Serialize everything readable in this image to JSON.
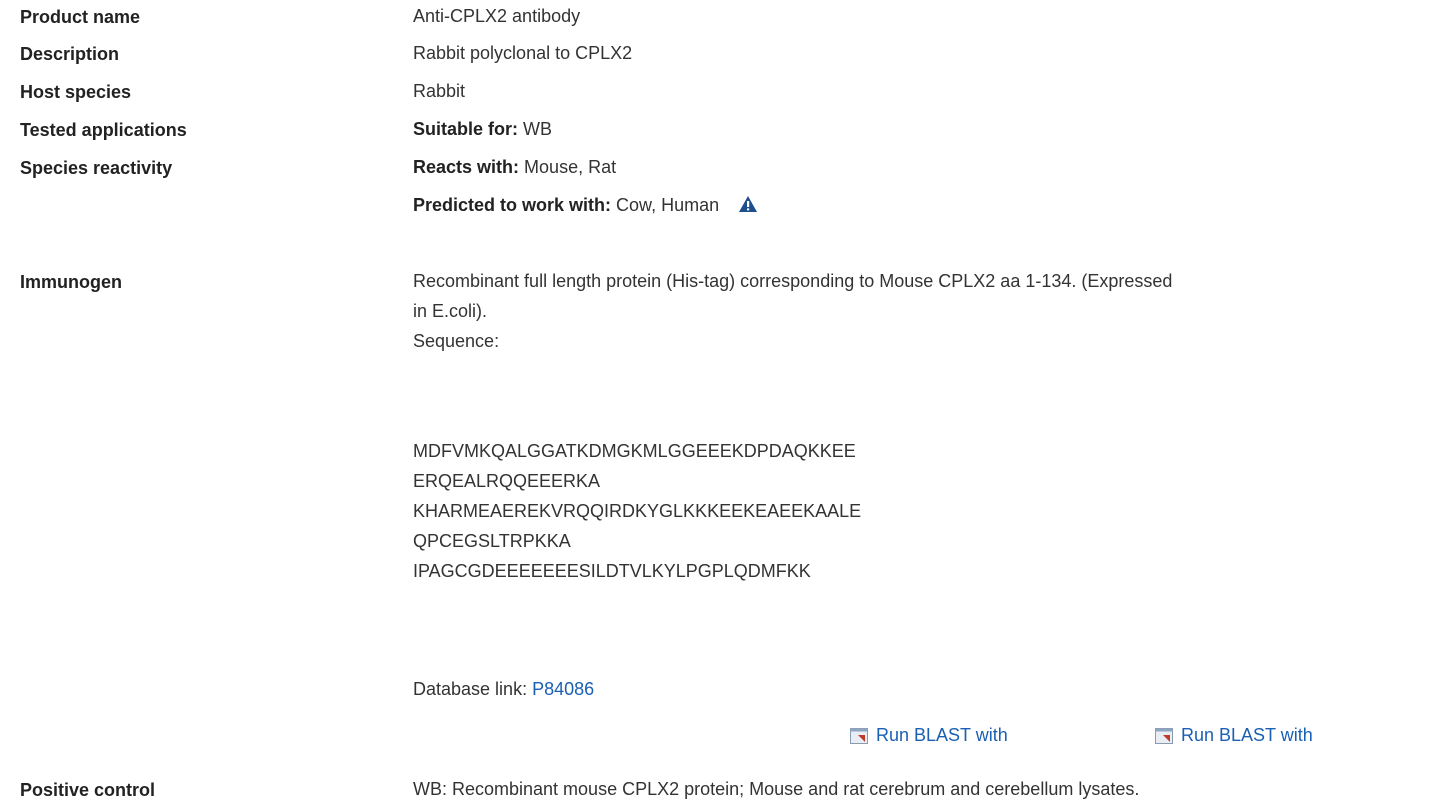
{
  "rows": {
    "product_name": {
      "label": "Product name",
      "value": "Anti-CPLX2 antibody"
    },
    "description": {
      "label": "Description",
      "value": "Rabbit polyclonal to CPLX2"
    },
    "host_species": {
      "label": "Host species",
      "value": "Rabbit"
    },
    "tested_applications": {
      "label": "Tested applications",
      "prefix": "Suitable for:",
      "value": "WB"
    },
    "species_reactivity": {
      "label": "Species reactivity",
      "reacts_prefix": "Reacts with:",
      "reacts_value": "Mouse, Rat",
      "predicted_prefix": "Predicted to work with:",
      "predicted_value": "Cow, Human"
    },
    "immunogen": {
      "label": "Immunogen",
      "text_line1": "Recombinant full length protein (His-tag) corresponding to Mouse CPLX2 aa 1-134. (Expressed",
      "text_line2": "in E.coli).",
      "sequence_label": "Sequence:",
      "sequence": [
        "MDFVMKQALGGATKDMGKMLGGEEEKDPDAQKKEE",
        "ERQEALRQQEEERKA",
        "KHARMEAEREKVRQQIRDKYGLKKKEEKEAEEKAALE",
        "QPCEGSLTRPKKA",
        "IPAGCGDEEEEEEESILDTVLKYLPGPLQDMFKK"
      ],
      "database_label": "Database link:",
      "database_link": "P84086",
      "blast_1": "Run BLAST with",
      "blast_2": "Run BLAST with"
    },
    "positive_control": {
      "label": "Positive control",
      "value": "WB: Recombinant mouse CPLX2 protein; Mouse and rat cerebrum and cerebellum lysates."
    }
  },
  "colors": {
    "link": "#1a5fb4",
    "warning_icon": "#1f4e8c"
  },
  "icons": {
    "warning": "warning-triangle-icon",
    "external": "external-link-icon"
  }
}
